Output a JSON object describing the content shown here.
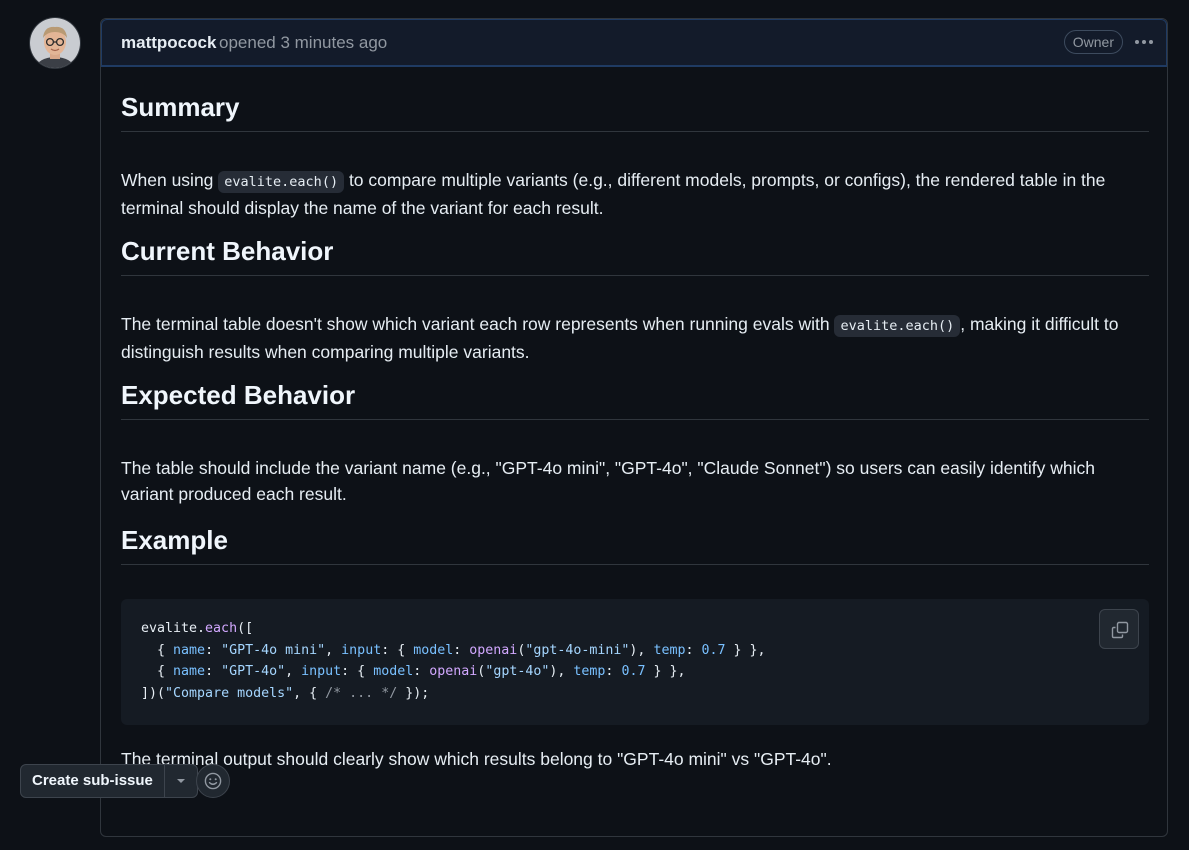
{
  "header": {
    "author": "mattpocock",
    "meta": "opened 3 minutes ago",
    "badge": "Owner"
  },
  "sections": {
    "summary": {
      "title": "Summary",
      "before": "When using ",
      "code": "evalite.each()",
      "after": " to compare multiple variants (e.g., different models, prompts, or configs), the rendered table in the terminal should display the name of the variant for each result."
    },
    "current": {
      "title": "Current Behavior",
      "before": "The terminal table doesn't show which variant each row represents when running evals with ",
      "code": "evalite.each()",
      "after": ", making it difficult to distinguish results when comparing multiple variants."
    },
    "expected": {
      "title": "Expected Behavior",
      "text": "The table should include the variant name (e.g., \"GPT-4o mini\", \"GPT-4o\", \"Claude Sonnet\") so users can easily identify which variant produced each result."
    },
    "example": {
      "title": "Example",
      "code_lines": [
        "evalite.each([",
        "  { name: \"GPT-4o mini\", input: { model: openai(\"gpt-4o-mini\"), temp: 0.7 } },",
        "  { name: \"GPT-4o\", input: { model: openai(\"gpt-4o\"), temp: 0.7 } },",
        "])(\"Compare models\", { /* ... */ });"
      ],
      "footer": "The terminal output should clearly show which results belong to \"GPT-4o mini\" vs \"GPT-4o\"."
    }
  },
  "actions": {
    "create_sub_issue": "Create sub-issue"
  },
  "icons": {
    "more": "kebab-horizontal-icon",
    "copy": "copy-icon",
    "dropdown": "triangle-down-icon",
    "reaction": "smiley-icon"
  }
}
